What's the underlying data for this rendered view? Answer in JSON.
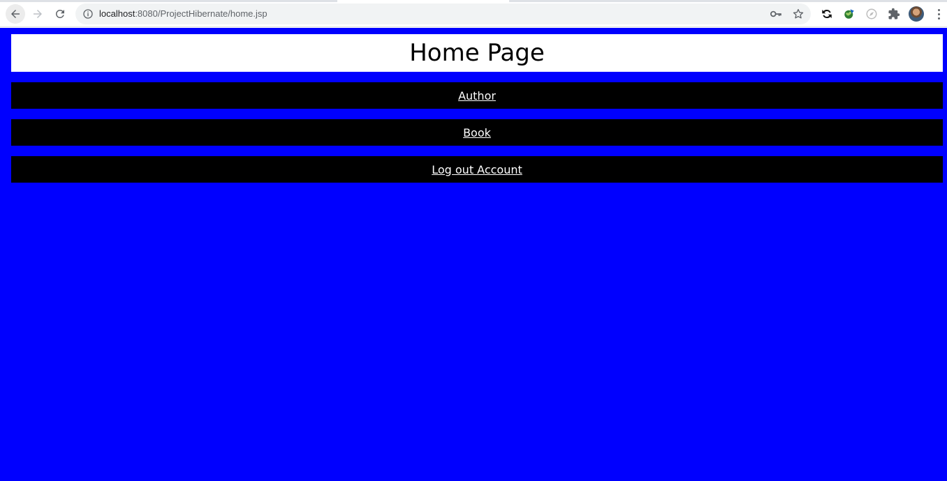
{
  "browser": {
    "url_host": "localhost",
    "url_path": ":8080/ProjectHibernate/home.jsp"
  },
  "page": {
    "title": "Home Page",
    "links": [
      {
        "label": "Author"
      },
      {
        "label": "Book"
      },
      {
        "label": "Log out Account"
      }
    ]
  },
  "colors": {
    "page_background": "#0000ff",
    "header_background": "#ffffff",
    "nav_background": "#000000",
    "link_text": "#ffffff"
  },
  "icons": {
    "back": "back-arrow-icon",
    "forward": "forward-arrow-icon",
    "reload": "reload-icon",
    "info": "info-icon",
    "key": "key-icon",
    "star": "star-icon",
    "extensions": [
      "sync-extension-icon",
      "globe-extension-icon",
      "compass-extension-icon",
      "puzzle-icon"
    ],
    "menu": "menu-dots-icon"
  }
}
